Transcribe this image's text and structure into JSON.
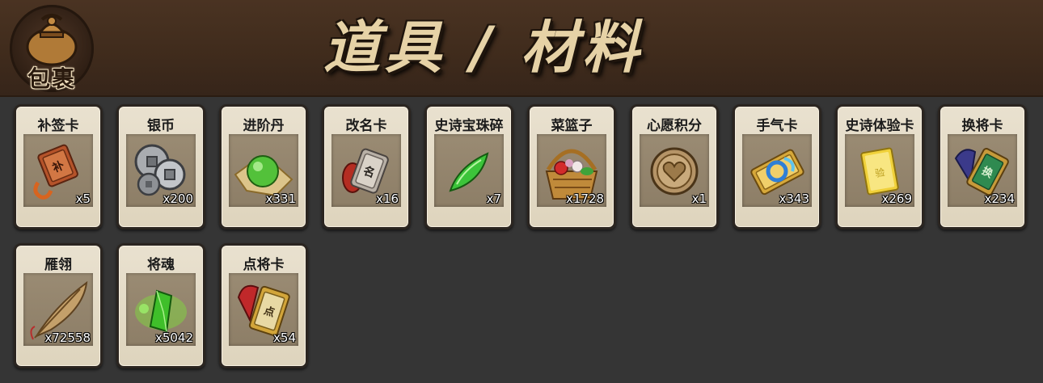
{
  "header": {
    "badge_label": "包裹",
    "title": "道具 / 材料"
  },
  "items": [
    {
      "name": "补签卡",
      "qty": "x5",
      "icon": "sign-card-icon"
    },
    {
      "name": "银币",
      "qty": "x200",
      "icon": "silver-coin-icon"
    },
    {
      "name": "进阶丹",
      "qty": "x331",
      "icon": "advance-pill-icon"
    },
    {
      "name": "改名卡",
      "qty": "x16",
      "icon": "rename-card-icon"
    },
    {
      "name": "史诗宝珠碎",
      "qty": "x7",
      "icon": "epic-gem-shard-icon"
    },
    {
      "name": "菜篮子",
      "qty": "x1728",
      "icon": "basket-icon"
    },
    {
      "name": "心愿积分",
      "qty": "x1",
      "icon": "wish-coin-icon"
    },
    {
      "name": "手气卡",
      "qty": "x343",
      "icon": "luck-card-icon"
    },
    {
      "name": "史诗体验卡",
      "qty": "x269",
      "icon": "epic-trial-card-icon"
    },
    {
      "name": "换将卡",
      "qty": "x234",
      "icon": "swap-general-card-icon"
    },
    {
      "name": "雁翎",
      "qty": "x72558",
      "icon": "feather-icon"
    },
    {
      "name": "将魂",
      "qty": "x5042",
      "icon": "general-soul-icon"
    },
    {
      "name": "点将卡",
      "qty": "x54",
      "icon": "pick-general-card-icon"
    }
  ]
}
